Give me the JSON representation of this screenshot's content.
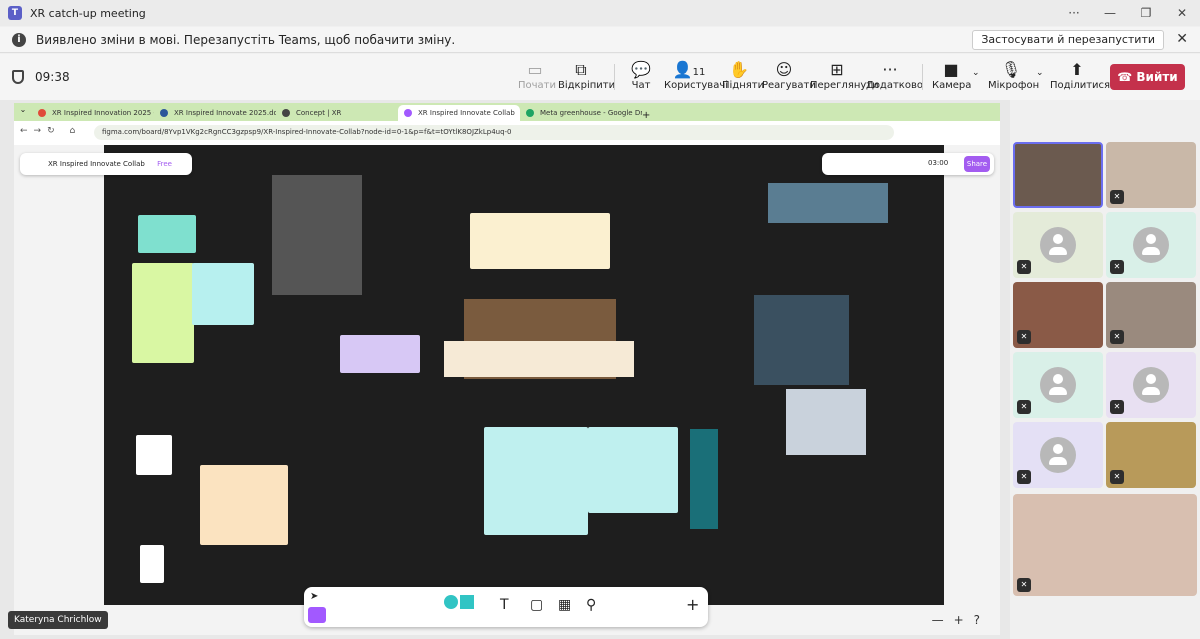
{
  "window": {
    "title": "XR catch-up meeting"
  },
  "notice": {
    "text": "Виявлено зміни в мові. Перезапустіть Teams, щоб побачити зміну.",
    "button": "Застосувати й перезапустити"
  },
  "toolbar": {
    "time": "09:38",
    "items": [
      {
        "label": "Почати",
        "icon": "cast-icon"
      },
      {
        "label": "Відкріпити",
        "icon": "unpin-icon"
      },
      {
        "label": "Чат",
        "icon": "chat-icon"
      },
      {
        "label": "Користувачі",
        "icon": "people-icon",
        "count": "11"
      },
      {
        "label": "Підняти",
        "icon": "raise-hand-icon"
      },
      {
        "label": "Реагувати",
        "icon": "emoji-icon"
      },
      {
        "label": "Переглянути",
        "icon": "view-icon"
      },
      {
        "label": "Додатково",
        "icon": "more-icon"
      },
      {
        "label": "Камера",
        "icon": "camera-icon"
      },
      {
        "label": "Мікрофон",
        "icon": "mic-off-icon"
      },
      {
        "label": "Поділитися",
        "icon": "share-icon"
      }
    ],
    "leave": "Вийти",
    "leave_color": "#c4314b"
  },
  "browser": {
    "tabs": [
      {
        "label": "XR Inspired Innovation 2025 - C",
        "color": "#e04b3a"
      },
      {
        "label": "XR Inspired Innovate 2025.docx",
        "color": "#2b579a"
      },
      {
        "label": "Concept | XR",
        "color": "#444444"
      },
      {
        "label": "XR Inspired Innovate Collab",
        "color": "#a259ff"
      },
      {
        "label": "Meta greenhouse - Google Dri",
        "color": "#1fa463"
      }
    ],
    "url": "figma.com/board/8Yvp1VKg2cRgnCC3gzpsp9/XR-Inspired-Innovate-Collab?node-id=0-1&p=f&t=tOYtlK8OJZkLp4uq-0"
  },
  "figma": {
    "file_name": "XR Inspired Innovate Collab",
    "plan": "Free",
    "timer": "03:00",
    "share": "Share",
    "zoom_icons": [
      "—",
      "+",
      "?"
    ]
  },
  "presenter": "Kateryna Chrichlow"
}
